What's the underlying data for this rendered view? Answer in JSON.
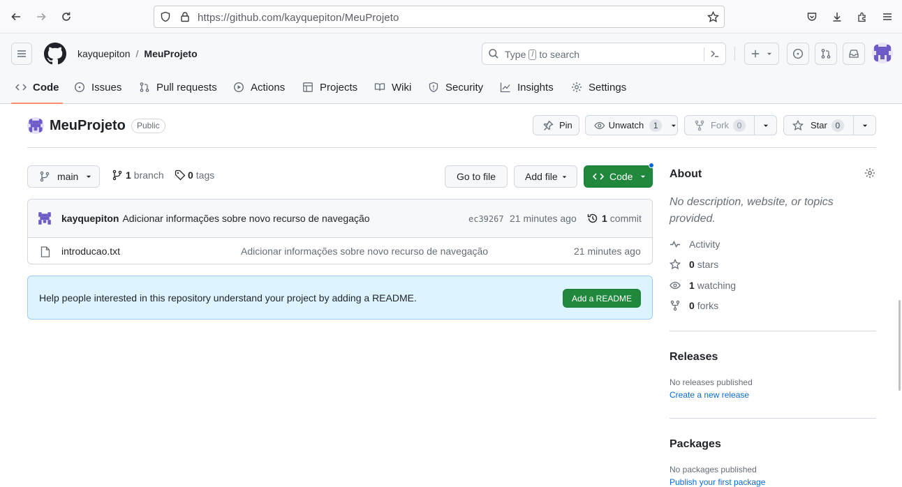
{
  "browser": {
    "url": "https://github.com/kayquepiton/MeuProjeto"
  },
  "header": {
    "owner": "kayquepiton",
    "separator": "/",
    "repo": "MeuProjeto",
    "search_prefix": "Type",
    "search_key": "/",
    "search_suffix": "to search"
  },
  "tabs": [
    {
      "label": "Code",
      "icon": "code-icon"
    },
    {
      "label": "Issues",
      "icon": "issue-icon"
    },
    {
      "label": "Pull requests",
      "icon": "pull-request-icon"
    },
    {
      "label": "Actions",
      "icon": "play-icon"
    },
    {
      "label": "Projects",
      "icon": "table-icon"
    },
    {
      "label": "Wiki",
      "icon": "book-icon"
    },
    {
      "label": "Security",
      "icon": "shield-icon"
    },
    {
      "label": "Insights",
      "icon": "graph-icon"
    },
    {
      "label": "Settings",
      "icon": "gear-icon"
    }
  ],
  "repo": {
    "name": "MeuProjeto",
    "visibility": "Public",
    "pin_label": "Pin",
    "unwatch_label": "Unwatch",
    "unwatch_count": "1",
    "fork_label": "Fork",
    "fork_count": "0",
    "star_label": "Star",
    "star_count": "0"
  },
  "toolbar": {
    "branch": "main",
    "branch_count": "1",
    "branch_label": "branch",
    "tag_count": "0",
    "tag_label": "tags",
    "go_to_file": "Go to file",
    "add_file": "Add file",
    "code": "Code"
  },
  "commit": {
    "author": "kayquepiton",
    "message": "Adicionar informações sobre novo recurso de navegação",
    "sha": "ec39267",
    "time": "21 minutes ago",
    "count": "1",
    "count_label": "commit"
  },
  "files": [
    {
      "name": "introducao.txt",
      "message": "Adicionar informações sobre novo recurso de navegação",
      "time": "21 minutes ago"
    }
  ],
  "readme": {
    "text": "Help people interested in this repository understand your project by adding a README.",
    "button": "Add a README"
  },
  "about": {
    "title": "About",
    "description": "No description, website, or topics provided.",
    "activity": "Activity",
    "stars_count": "0",
    "stars_label": "stars",
    "watching_count": "1",
    "watching_label": "watching",
    "forks_count": "0",
    "forks_label": "forks"
  },
  "releases": {
    "title": "Releases",
    "empty": "No releases published",
    "link": "Create a new release"
  },
  "packages": {
    "title": "Packages",
    "empty": "No packages published",
    "link": "Publish your first package"
  },
  "colors": {
    "primary_button": "#1f883d",
    "link": "#0969da",
    "tab_underline": "#fd8c73",
    "readme_bg": "#ddf4ff"
  }
}
